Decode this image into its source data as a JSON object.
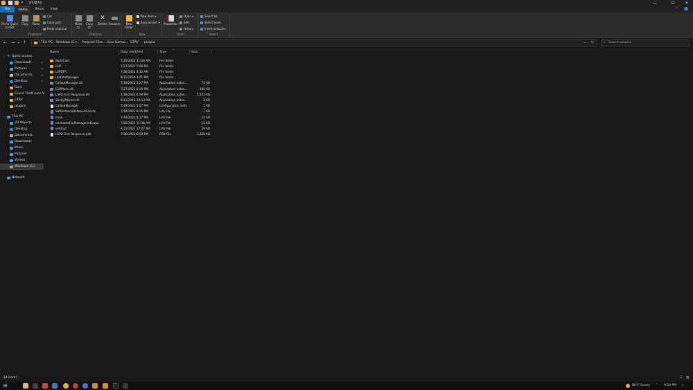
{
  "window": {
    "title": "plugins",
    "controls": {
      "minimize": "—",
      "maximize": "☐",
      "close": "✕"
    }
  },
  "ribbon_tabs": [
    "File",
    "Home",
    "Share",
    "View"
  ],
  "ribbon": {
    "clipboard": {
      "pin": "Pin to Quick access",
      "copy": "Copy",
      "paste": "Paste",
      "cut": "Cut",
      "copy_path": "Copy path",
      "paste_shortcut": "Paste shortcut",
      "label": "Clipboard"
    },
    "organize": {
      "move_to": "Move to",
      "copy_to": "Copy to",
      "delete": "Delete",
      "rename": "Rename",
      "label": "Organize"
    },
    "new": {
      "new_folder": "New folder",
      "new_item": "New item",
      "easy_access": "Easy access",
      "label": "New"
    },
    "open": {
      "properties": "Properties",
      "open": "Open",
      "edit": "Edit",
      "history": "History",
      "label": "Open"
    },
    "select": {
      "select_all": "Select all",
      "select_none": "Select none",
      "invert": "Invert selection",
      "label": "Select"
    }
  },
  "address": {
    "crumbs": [
      "This PC",
      "Windows (C:)",
      "Program Files",
      "Epic Games",
      "GTAV",
      "plugins"
    ],
    "search_placeholder": "Search plugins"
  },
  "nav": {
    "quick_access": "Quick access",
    "quick_items": [
      "Downloads",
      "Pictures",
      "Documents",
      "Desktop",
      "Docs",
      "Grand Theft Auto V",
      "GTAV",
      "plugins"
    ],
    "this_pc": "This PC",
    "pc_items": [
      "3D Objects",
      "Desktop",
      "Documents",
      "Downloads",
      "Music",
      "Pictures",
      "Videos",
      "Windows (C:)"
    ],
    "network": "Network"
  },
  "columns": {
    "name": "Name",
    "date": "Date modified",
    "type": "Type",
    "size": "Size"
  },
  "files": [
    {
      "name": "BodyCam",
      "date": "7/20/2022 11:04 AM",
      "type": "File folder",
      "size": "",
      "kind": "folder"
    },
    {
      "name": "EUP",
      "date": "7/27/2022 5:58 PM",
      "type": "File folder",
      "size": "",
      "kind": "folder"
    },
    {
      "name": "LSPDFR",
      "date": "7/28/2022 3:32 AM",
      "type": "File folder",
      "size": "",
      "kind": "folder"
    },
    {
      "name": "UpdateManager",
      "date": "8/15/2016 3:01 PM",
      "type": "File folder",
      "size": "",
      "kind": "folder"
    },
    {
      "name": "CalloutManager.dll",
      "date": "7/19/2022 5:27 PM",
      "type": "Application exten...",
      "size": "73 KB",
      "kind": "app"
    },
    {
      "name": "EUPMenu.dll",
      "date": "7/27/2022 8:20 PM",
      "type": "Application exten...",
      "size": "485 KB",
      "kind": "app"
    },
    {
      "name": "LSPD First Response.dll",
      "date": "7/26/2022 6:59 PM",
      "type": "Application exten...",
      "size": "5,572 KB",
      "kind": "app"
    },
    {
      "name": "StickyWheels.dll",
      "date": "9/11/2016 10:53 PM",
      "type": "Application exten...",
      "size": "5 KB",
      "kind": "app"
    },
    {
      "name": "CalloutManager",
      "date": "7/19/2022 5:27 PM",
      "type": "Configuration setti...",
      "size": "1 KB",
      "kind": "file"
    },
    {
      "name": "SetDistanceBetweenCoords",
      "date": "7/19/2022 8:25 PM",
      "type": "LUA File",
      "size": "1 KB",
      "kind": "lua"
    },
    {
      "name": "main",
      "date": "7/19/2022 8:17 PM",
      "type": "LUA File",
      "size": "15 KB",
      "kind": "lua"
    },
    {
      "name": "mrzhasteCarDamageIndicator",
      "date": "7/20/2022 11:38 AM",
      "type": "LUA File",
      "size": "15 KB",
      "kind": "lua"
    },
    {
      "name": "vehhud",
      "date": "4/21/2022 12:07 AM",
      "type": "LUA File",
      "size": "59 KB",
      "kind": "lua"
    },
    {
      "name": "LSPD First Response.pdb",
      "date": "7/26/2022 6:59 PM",
      "type": "PDB File",
      "size": "3,228 KB",
      "kind": "file"
    }
  ],
  "status": {
    "items": "14 items"
  },
  "taskbar": {
    "weather": "80°F Sunny",
    "time": "9:54 PM"
  },
  "colors": {
    "accent": "#1a6fc1",
    "folder": "#e8b84d",
    "background": "#191919",
    "ribbon": "#2b2b2b"
  }
}
